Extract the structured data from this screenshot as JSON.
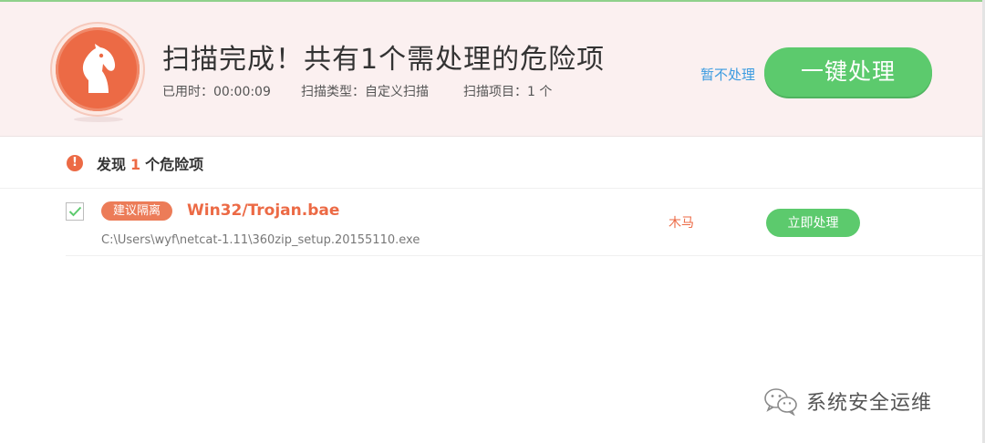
{
  "colors": {
    "accent_orange": "#ec6a45",
    "button_green": "#5cca6d",
    "link_blue": "#3b9be0",
    "header_bg": "#fbf0f0"
  },
  "header": {
    "logo_icon": "horse-head-icon",
    "title": "扫描完成！共有1个需处理的危险项",
    "elapsed": "已用时：00:00:09",
    "scan_type": "扫描类型：自定义扫描",
    "scan_items": "扫描项目：1 个",
    "skip_label": "暂不处理",
    "fix_all_label": "一键处理"
  },
  "summary": {
    "prefix": "发现",
    "count": "1",
    "suffix": "个危险项",
    "icon": "alert-icon"
  },
  "threats": [
    {
      "checked": true,
      "tag": "建议隔离",
      "name": "Win32/Trojan.bae",
      "path": "C:\\Users\\wyf\\netcat-1.11\\360zip_setup.20155110.exe",
      "type": "木马",
      "action_label": "立即处理"
    }
  ],
  "watermark": {
    "icon": "wechat-icon",
    "text": "系统安全运维"
  }
}
